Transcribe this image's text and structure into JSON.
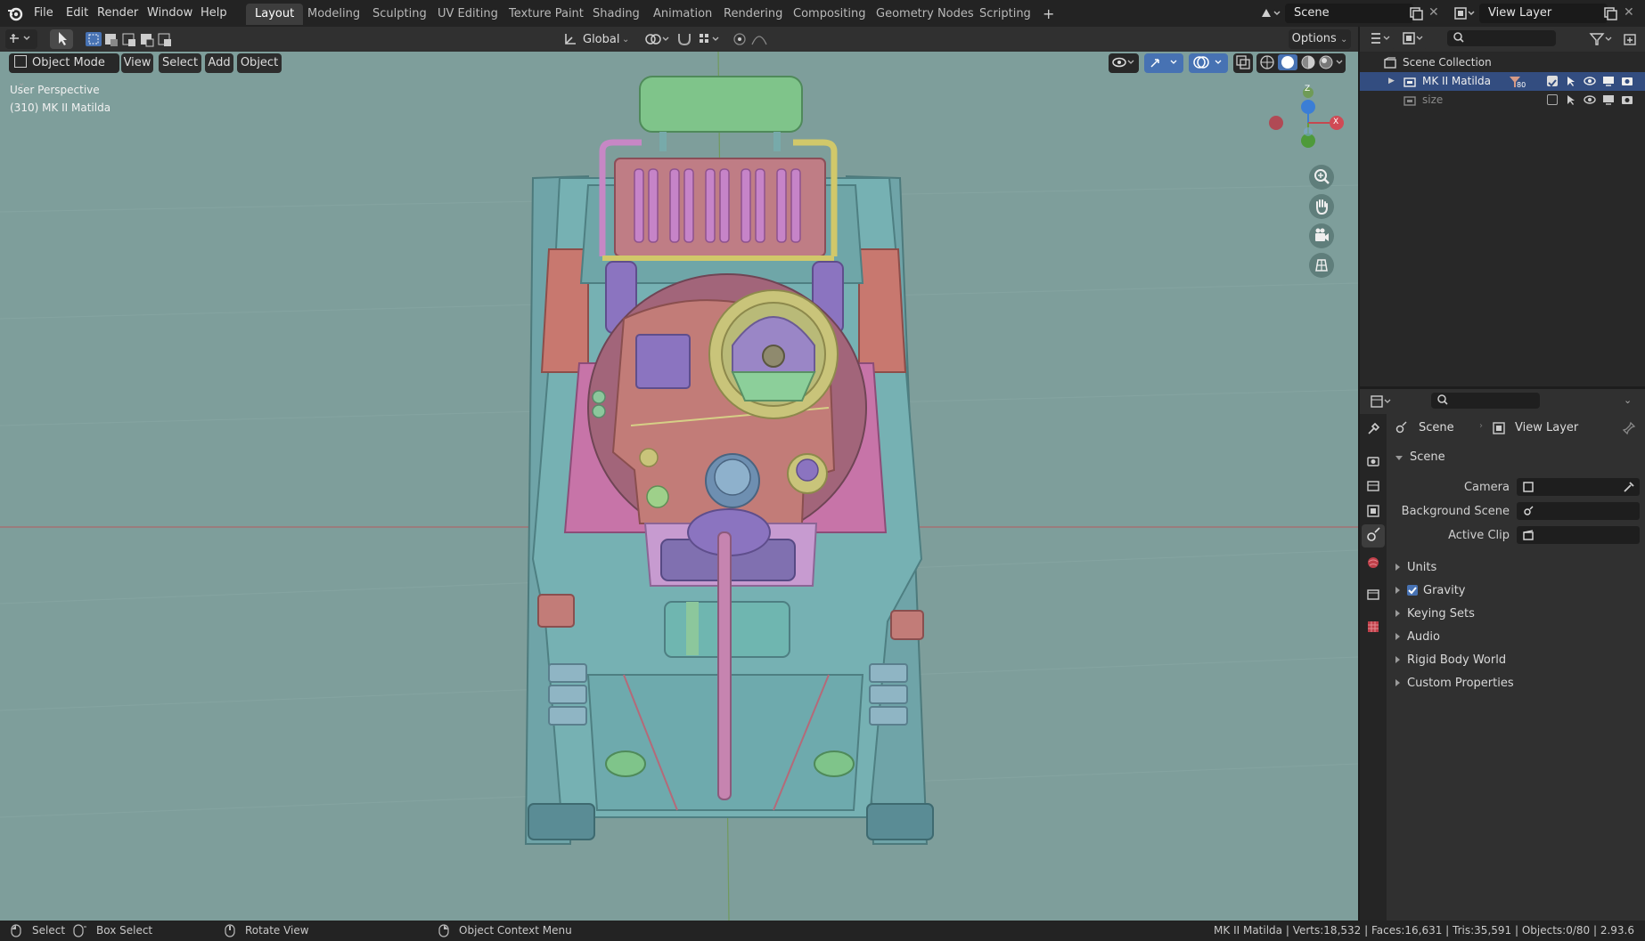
{
  "topbar": {
    "menus": [
      "File",
      "Edit",
      "Render",
      "Window",
      "Help"
    ],
    "workspaces": [
      "Layout",
      "Modeling",
      "Sculpting",
      "UV Editing",
      "Texture Paint",
      "Shading",
      "Animation",
      "Rendering",
      "Compositing",
      "Geometry Nodes",
      "Scripting"
    ],
    "active_workspace": "Layout",
    "add_tab": "+",
    "scene_name": "Scene",
    "view_layer_name": "View Layer"
  },
  "viewport_header": {
    "transform_orientation": "Global",
    "options_label": "Options",
    "mode": "Object Mode",
    "menu_view": "View",
    "menu_select": "Select",
    "menu_add": "Add",
    "menu_object": "Object"
  },
  "viewport": {
    "perspective_label": "User Perspective",
    "object_label": "(310) MK II Matilda",
    "gizmo_z": "Z",
    "gizmo_x": "X",
    "gizmo_y": "Y"
  },
  "outliner": {
    "root": "Scene Collection",
    "items": [
      {
        "name": "MK II Matilda",
        "badge": "80"
      },
      {
        "name": "size"
      }
    ]
  },
  "properties": {
    "breadcrumb_scene": "Scene",
    "breadcrumb_view_layer": "View Layer",
    "section_title": "Scene",
    "camera_label": "Camera",
    "background_scene_label": "Background Scene",
    "active_clip_label": "Active Clip",
    "panels": [
      "Units",
      "Gravity",
      "Keying Sets",
      "Audio",
      "Rigid Body World",
      "Custom Properties"
    ],
    "gravity_checked": true
  },
  "statusbar": {
    "select": "Select",
    "box_select": "Box Select",
    "rotate_view": "Rotate View",
    "context_menu": "Object Context Menu",
    "stats": "MK II Matilda | Verts:18,532 | Faces:16,631 | Tris:35,591 | Objects:0/80 | 2.93.6"
  },
  "colors": {
    "viewport_bg": "#7e9e9b",
    "accent_blue": "#4772b3",
    "x_axis": "#c5484f",
    "y_axis": "#6a9a3a",
    "z_axis": "#3b7ed6"
  }
}
